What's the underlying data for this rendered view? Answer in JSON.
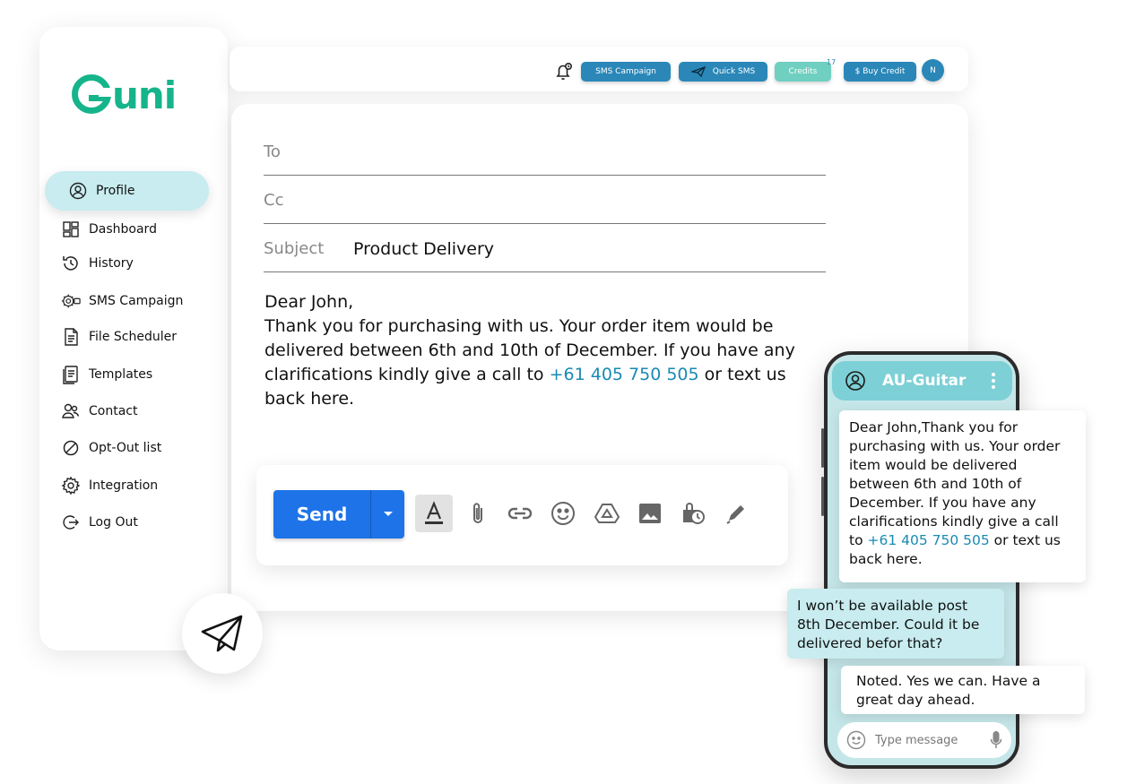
{
  "brand": {
    "logo_text": "uni",
    "logo_initial": "G",
    "accent": "#16b48a"
  },
  "sidebar": {
    "items": [
      {
        "label": "Profile",
        "icon": "user-circle-icon",
        "active": true
      },
      {
        "label": "Dashboard",
        "icon": "dashboard-icon"
      },
      {
        "label": "History",
        "icon": "history-icon"
      },
      {
        "label": "SMS Campaign",
        "icon": "gear-icon"
      },
      {
        "label": "File Scheduler",
        "icon": "file-icon"
      },
      {
        "label": "Templates",
        "icon": "templates-icon"
      },
      {
        "label": "Contact",
        "icon": "contact-icon"
      },
      {
        "label": "Opt-Out list",
        "icon": "block-icon"
      },
      {
        "label": "Integration",
        "icon": "settings-icon"
      },
      {
        "label": "Log Out",
        "icon": "logout-icon"
      }
    ]
  },
  "topbar": {
    "sms_campaign": "SMS Campaign",
    "quick_sms": "Quick SMS",
    "credits": "Credits",
    "credits_count": "17",
    "buy_credit": "$ Buy Credit",
    "avatar_initial": "N",
    "colors": {
      "button": "#2a87b8",
      "credits": "#6fcfc0"
    }
  },
  "compose": {
    "to_label": "To",
    "cc_label": "Cc",
    "subject_label": "Subject",
    "subject_value": "Product Delivery",
    "greeting": "Dear John,",
    "body_before_phone": "Thank you for purchasing with us. Your order item would be delivered between 6th and 10th of December. If you have any clarifications kindly give a call to ",
    "phone": "+61 405 750 505",
    "body_after_phone": " or text us back here."
  },
  "toolbar": {
    "send_label": "Send",
    "tools": [
      "text-format-icon",
      "attach-icon",
      "link-icon",
      "emoji-icon",
      "drive-icon",
      "image-icon",
      "schedule-icon",
      "signature-icon"
    ]
  },
  "phone": {
    "contact_name": "AU-Guitar",
    "message_1_before_phone": "Dear John,Thank you for purchasing with us. Your order item would be delivered between 6th and 10th of December. If you have any clarifications kindly give a call to ",
    "message_1_phone": "+61 405 750 505",
    "message_1_after_phone": " or text us back here.",
    "reply": "I won’t be available post 8th December. Could it be delivered befor that?",
    "message_2": "Noted. Yes we can. Have a great day ahead.",
    "input_placeholder": "Type message"
  }
}
